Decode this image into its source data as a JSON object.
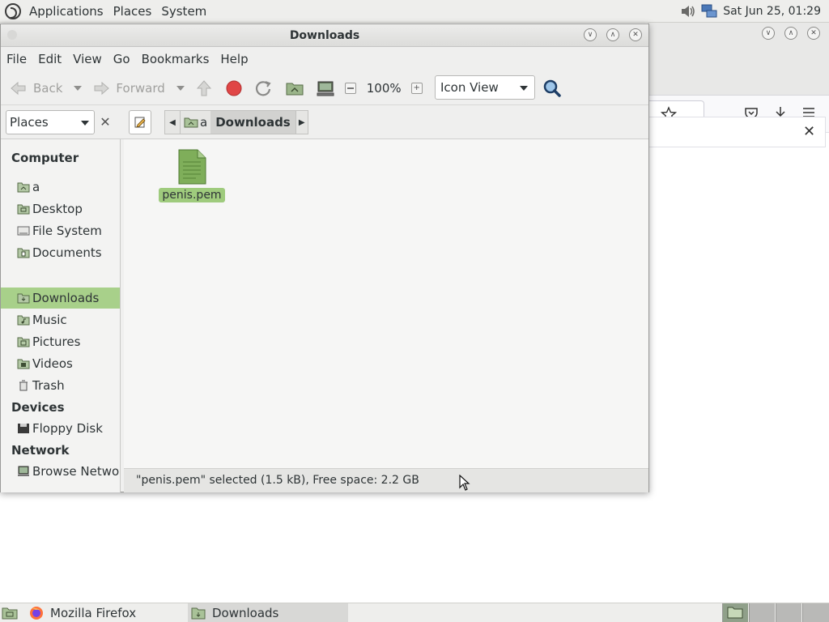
{
  "top_panel": {
    "menus": [
      "Applications",
      "Places",
      "System"
    ],
    "clock": "Sat Jun 25, 01:29"
  },
  "caja": {
    "title": "Downloads",
    "menubar": [
      "File",
      "Edit",
      "View",
      "Go",
      "Bookmarks",
      "Help"
    ],
    "toolbar": {
      "back": "Back",
      "forward": "Forward",
      "zoom": "100%",
      "view_mode": "Icon View"
    },
    "location": {
      "side_pane": "Places",
      "crumbs": [
        "a",
        "Downloads"
      ]
    },
    "sidebar": {
      "headings": [
        "Computer",
        "Devices",
        "Network"
      ],
      "computer_items": [
        "a",
        "Desktop",
        "File System",
        "Documents",
        "Downloads",
        "Music",
        "Pictures",
        "Videos",
        "Trash"
      ],
      "device_items": [
        "Floppy Disk"
      ],
      "network_items": [
        "Browse Netwo..."
      ]
    },
    "files": [
      {
        "name": "penis.pem",
        "selected": true
      }
    ],
    "status": "\"penis.pem\" selected (1.5 kB), Free space: 2.2 GB"
  },
  "taskbar": {
    "tasks": [
      "Mozilla Firefox",
      "Downloads"
    ]
  },
  "colors": {
    "selection": "#a8d08a",
    "panel": "#eeeeec",
    "folder": "#6e8a5b",
    "stop": "#e04646"
  }
}
